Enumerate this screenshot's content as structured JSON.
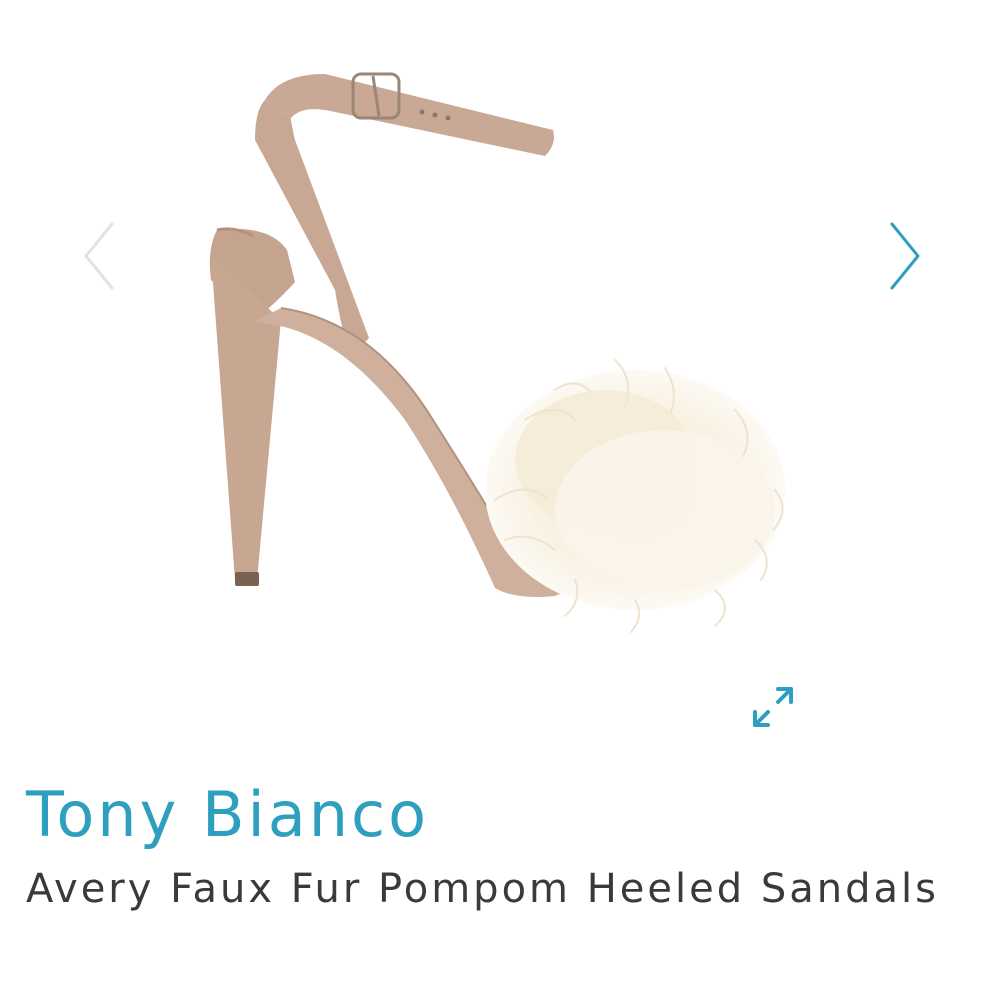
{
  "product": {
    "brand": "Tony Bianco",
    "name": "Avery Faux Fur Pompom Heeled Sandals"
  },
  "gallery": {
    "image_subject": "nude suede heeled sandal with ankle strap and white faux fur pompom",
    "prev_icon": "chevron-left-icon",
    "next_icon": "chevron-right-icon",
    "expand_icon": "expand-arrows-icon"
  },
  "colors": {
    "accent": "#2f9fbf",
    "text": "#3a3a3a",
    "arrow_disabled": "#e3e3e3",
    "background": "#ffffff"
  }
}
